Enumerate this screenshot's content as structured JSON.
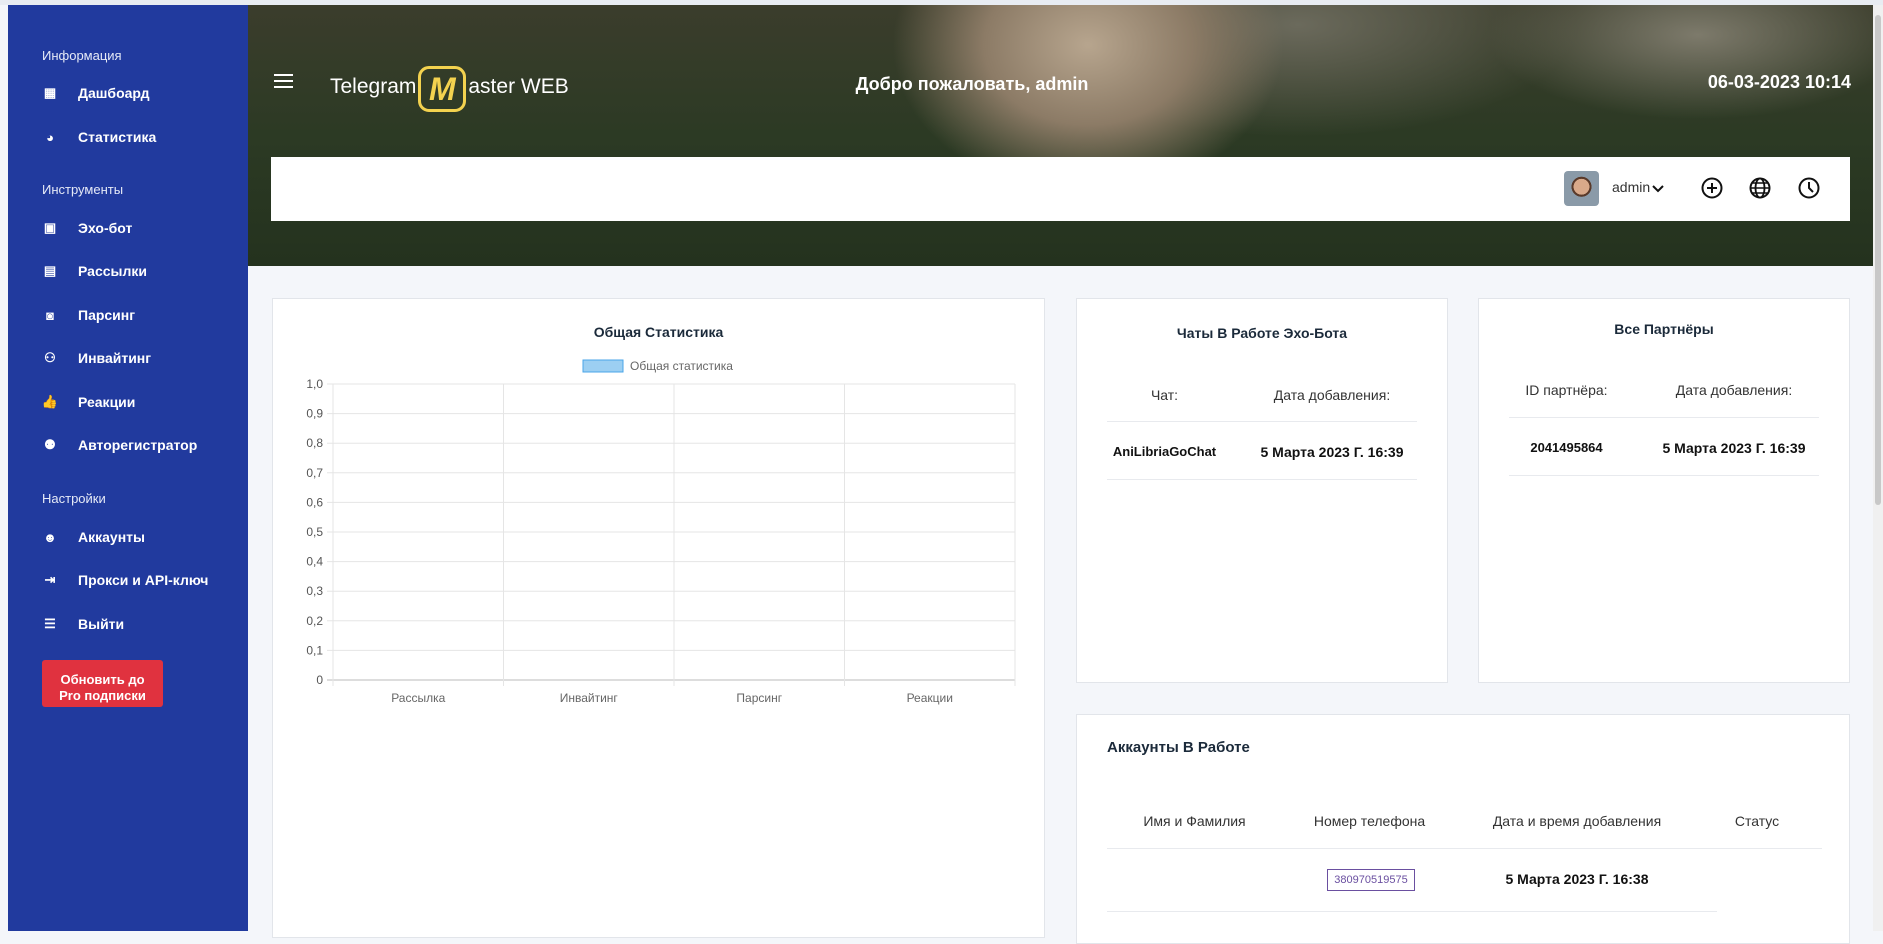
{
  "sidebar": {
    "sections": [
      "Информация",
      "Инструменты",
      "Настройки"
    ],
    "items": [
      {
        "label": "Дашбоард",
        "icon": "dashboard-icon"
      },
      {
        "label": "Статистика",
        "icon": "pie-chart-icon"
      },
      {
        "label": "Эхо-бот",
        "icon": "echo-bot-icon"
      },
      {
        "label": "Рассылки",
        "icon": "mailing-icon"
      },
      {
        "label": "Парсинг",
        "icon": "parsing-icon"
      },
      {
        "label": "Инвайтинг",
        "icon": "users-icon"
      },
      {
        "label": "Реакции",
        "icon": "thumbs-up-icon"
      },
      {
        "label": "Авторегистратор",
        "icon": "user-register-icon"
      },
      {
        "label": "Аккаунты",
        "icon": "user-circle-icon"
      },
      {
        "label": "Прокси и API-ключ",
        "icon": "login-icon"
      },
      {
        "label": "Выйти",
        "icon": "logout-icon"
      }
    ],
    "upgrade_label_1": "Обновить до",
    "upgrade_label_2": "Pro подписки"
  },
  "header": {
    "logo_left": "Telegram",
    "logo_mark": "M",
    "logo_right": "aster WEB",
    "welcome": "Добро пожаловать, admin",
    "datetime": "06-03-2023 10:14",
    "user": "admin"
  },
  "chart_data": {
    "type": "bar",
    "title": "Общая Статистика",
    "legend": [
      "Общая статистика"
    ],
    "legend_placement": "top",
    "categories": [
      "Рассылка",
      "Инвайтинг",
      "Парсинг",
      "Реакции"
    ],
    "values": [
      0,
      0,
      0,
      0
    ],
    "ylim": [
      0,
      1
    ],
    "yticks": [
      "0",
      "0,1",
      "0,2",
      "0,3",
      "0,4",
      "0,5",
      "0,6",
      "0,7",
      "0,8",
      "0,9",
      "1,0"
    ],
    "grid": true,
    "colors": {
      "fill": "#9ccff2",
      "stroke": "#4aa6e8"
    }
  },
  "chats": {
    "title": "Чаты В Работе Эхо-Бота",
    "headers": [
      "Чат:",
      "Дата добавления:"
    ],
    "rows": [
      [
        "AniLibriaGoChat",
        "5 Марта 2023 Г. 16:39"
      ]
    ]
  },
  "partners": {
    "title": "Все Партнёры",
    "headers": [
      "ID партнёра:",
      "Дата добавления:"
    ],
    "rows": [
      [
        "2041495864",
        "5 Марта 2023 Г. 16:39"
      ]
    ]
  },
  "accounts": {
    "title": "Аккаунты В Работе",
    "headers": [
      "Имя и Фамилия",
      "Номер телефона",
      "Дата и время добавления",
      "Статус"
    ],
    "rows": [
      [
        "",
        "380970519575",
        "5 Марта 2023 Г. 16:38",
        ""
      ]
    ]
  }
}
